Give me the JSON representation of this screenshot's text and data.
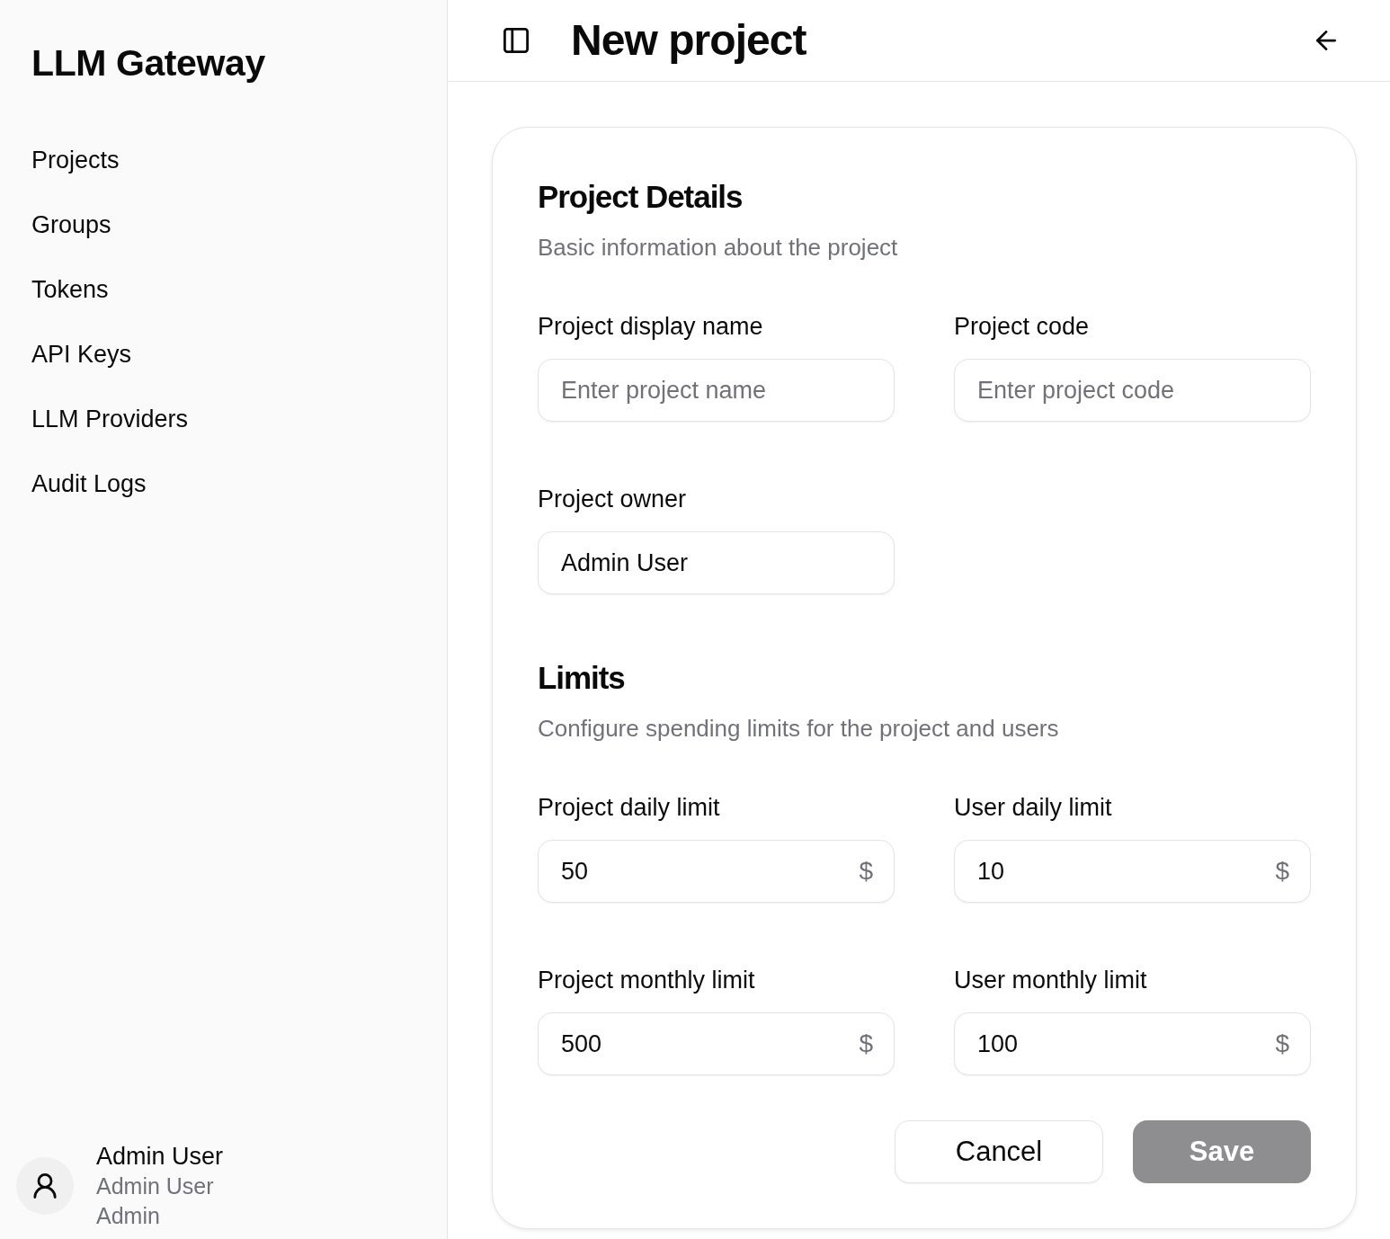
{
  "sidebar": {
    "title": "LLM Gateway",
    "items": [
      "Projects",
      "Groups",
      "Tokens",
      "API Keys",
      "LLM Providers",
      "Audit Logs"
    ],
    "user": {
      "name": "Admin User",
      "display_name": "Admin User",
      "role": "Admin"
    }
  },
  "header": {
    "title": "New project"
  },
  "form": {
    "sections": [
      {
        "title": "Project Details",
        "description": "Basic information about the project",
        "fields": [
          {
            "label": "Project display name",
            "placeholder": "Enter project name"
          },
          {
            "label": "Project code",
            "placeholder": "Enter project code"
          },
          {
            "label": "Project owner",
            "value": "Admin User"
          }
        ]
      },
      {
        "title": "Limits",
        "description": "Configure spending limits for the project and users",
        "fields": [
          {
            "label": "Project daily limit",
            "value": "50",
            "suffix": "$"
          },
          {
            "label": "User daily limit",
            "value": "10",
            "suffix": "$"
          },
          {
            "label": "Project monthly limit",
            "value": "500",
            "suffix": "$"
          },
          {
            "label": "User monthly limit",
            "value": "100",
            "suffix": "$"
          }
        ]
      }
    ],
    "buttons": [
      {
        "label": "Cancel",
        "kind": "outline",
        "disabled": false
      },
      {
        "label": "Save",
        "kind": "primary",
        "disabled": true
      }
    ]
  }
}
